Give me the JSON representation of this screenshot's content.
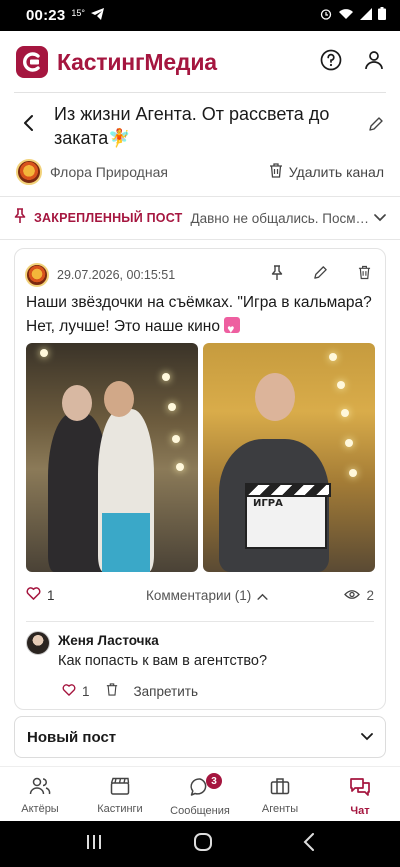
{
  "status_bar": {
    "time": "00:23",
    "temperature": "15°",
    "telegram_icon": "send-icon"
  },
  "app": {
    "brand": "КастингМедиа",
    "accent_color": "#a5163f"
  },
  "channel": {
    "title": "Из жизни Агента. От рассвета до заката🧚",
    "owner_name": "Флора Природная",
    "delete_label": "Удалить канал"
  },
  "pinned": {
    "label": "ЗАКРЕПЛЕННЫЙ ПОСТ",
    "preview": "Давно не общались. Посмотрите"
  },
  "post": {
    "date": "29.07.2026, 00:15:51",
    "text": "Наши звёздочки на съёмках. \"Игра в кальмара? Нет, лучше! Это наше кино ",
    "likes": "1",
    "comments_label": "Комментарии (1)",
    "views": "2",
    "clapper_text": "ИГРА"
  },
  "comment": {
    "author": "Женя Ласточка",
    "text": "Как попасть к вам в агентство?",
    "likes": "1",
    "ban_label": "Запретить"
  },
  "new_post": {
    "label": "Новый пост"
  },
  "tabs": [
    {
      "label": "Актёры",
      "icon": "users-icon"
    },
    {
      "label": "Кастинги",
      "icon": "clapperboard-icon"
    },
    {
      "label": "Сообщения",
      "icon": "chat-bubble-icon",
      "badge": "3"
    },
    {
      "label": "Агенты",
      "icon": "briefcase-icon"
    },
    {
      "label": "Чат",
      "icon": "chat-icon",
      "active": true
    }
  ]
}
